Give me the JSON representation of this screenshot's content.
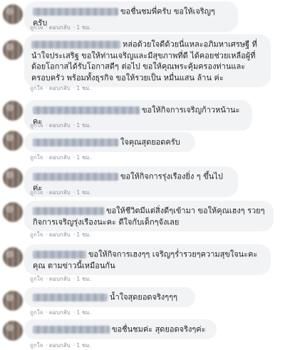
{
  "comments": [
    {
      "text": "ขอชื่นชมพี่ครับ ขอให้เจริญๆครับ",
      "like_label": "ถูกใจ",
      "reply_label": "ตอบกลับ",
      "time": "1 ชม."
    },
    {
      "text": "หล่อด้วยใจดีด้วยนี่แหละอภิมหาเศรษฐี ที่นำใจประเสริฐ ขอให้ท่านเจริญและมีสุขภาพที่ดี ได้คอยช่วยเหลือผู้ที่ด้อยโอกาสได้รับโอกาสดีๆ ต่อไป ขอให้คุณพระคุ้มครองท่านและครอบครัว พร้อมทั้งธุรกิจ ขอให้รวยเป็น หมื่นแสน ล้าน ค่ะ",
      "like_label": "ถูกใจ",
      "reply_label": "ตอบกลับ",
      "time": "1 ชม."
    },
    {
      "text": "ขอให้กิจการเจริญก้าวหน้านะคะ",
      "like_label": "ถูกใจ",
      "reply_label": "ตอบกลับ",
      "time": "1 ชม."
    },
    {
      "text": "ใจคุณสุดยอดครับ",
      "like_label": "ถูกใจ",
      "reply_label": "ตอบกลับ",
      "time": "1 ชม."
    },
    {
      "text": "ขอให้กิจการรุ่งเรืองยิ่ง ๆ ขึ้นไปค่ะ",
      "like_label": "ถูกใจ",
      "reply_label": "ตอบกลับ",
      "time": "1 ชม."
    },
    {
      "text": "ขอให้ชีวิตมีแต่สิ่งดีๆเข้ามา ขอให้คุณเฮงๆ รวยๆ กิจการเจริญรุ่งเรืองนะคะ ดีใจกับเด็กๆจังเลย",
      "like_label": "ถูกใจ",
      "reply_label": "ตอบกลับ",
      "time": "1 ชม."
    },
    {
      "text": "ขอให้กิจการเฮงๆๆ เจริญๆร่ำรวยๆความสุขใจนะคะคุณ ตามข่าวนี้เหมือนกัน",
      "like_label": "ถูกใจ",
      "reply_label": "ตอบกลับ",
      "time": "1 ชม."
    },
    {
      "text": "น้ำใจสุดยอดจริงๆๆๆ",
      "like_label": "ถูกใจ",
      "reply_label": "ตอบกลับ",
      "time": "1 ชม."
    },
    {
      "text": "ขอชื่นชมค่ะ สุดยอดจริงๆค่ะ",
      "like_label": "ถูกใจ",
      "reply_label": "ตอบกลับ",
      "time": "1 ชม."
    }
  ]
}
